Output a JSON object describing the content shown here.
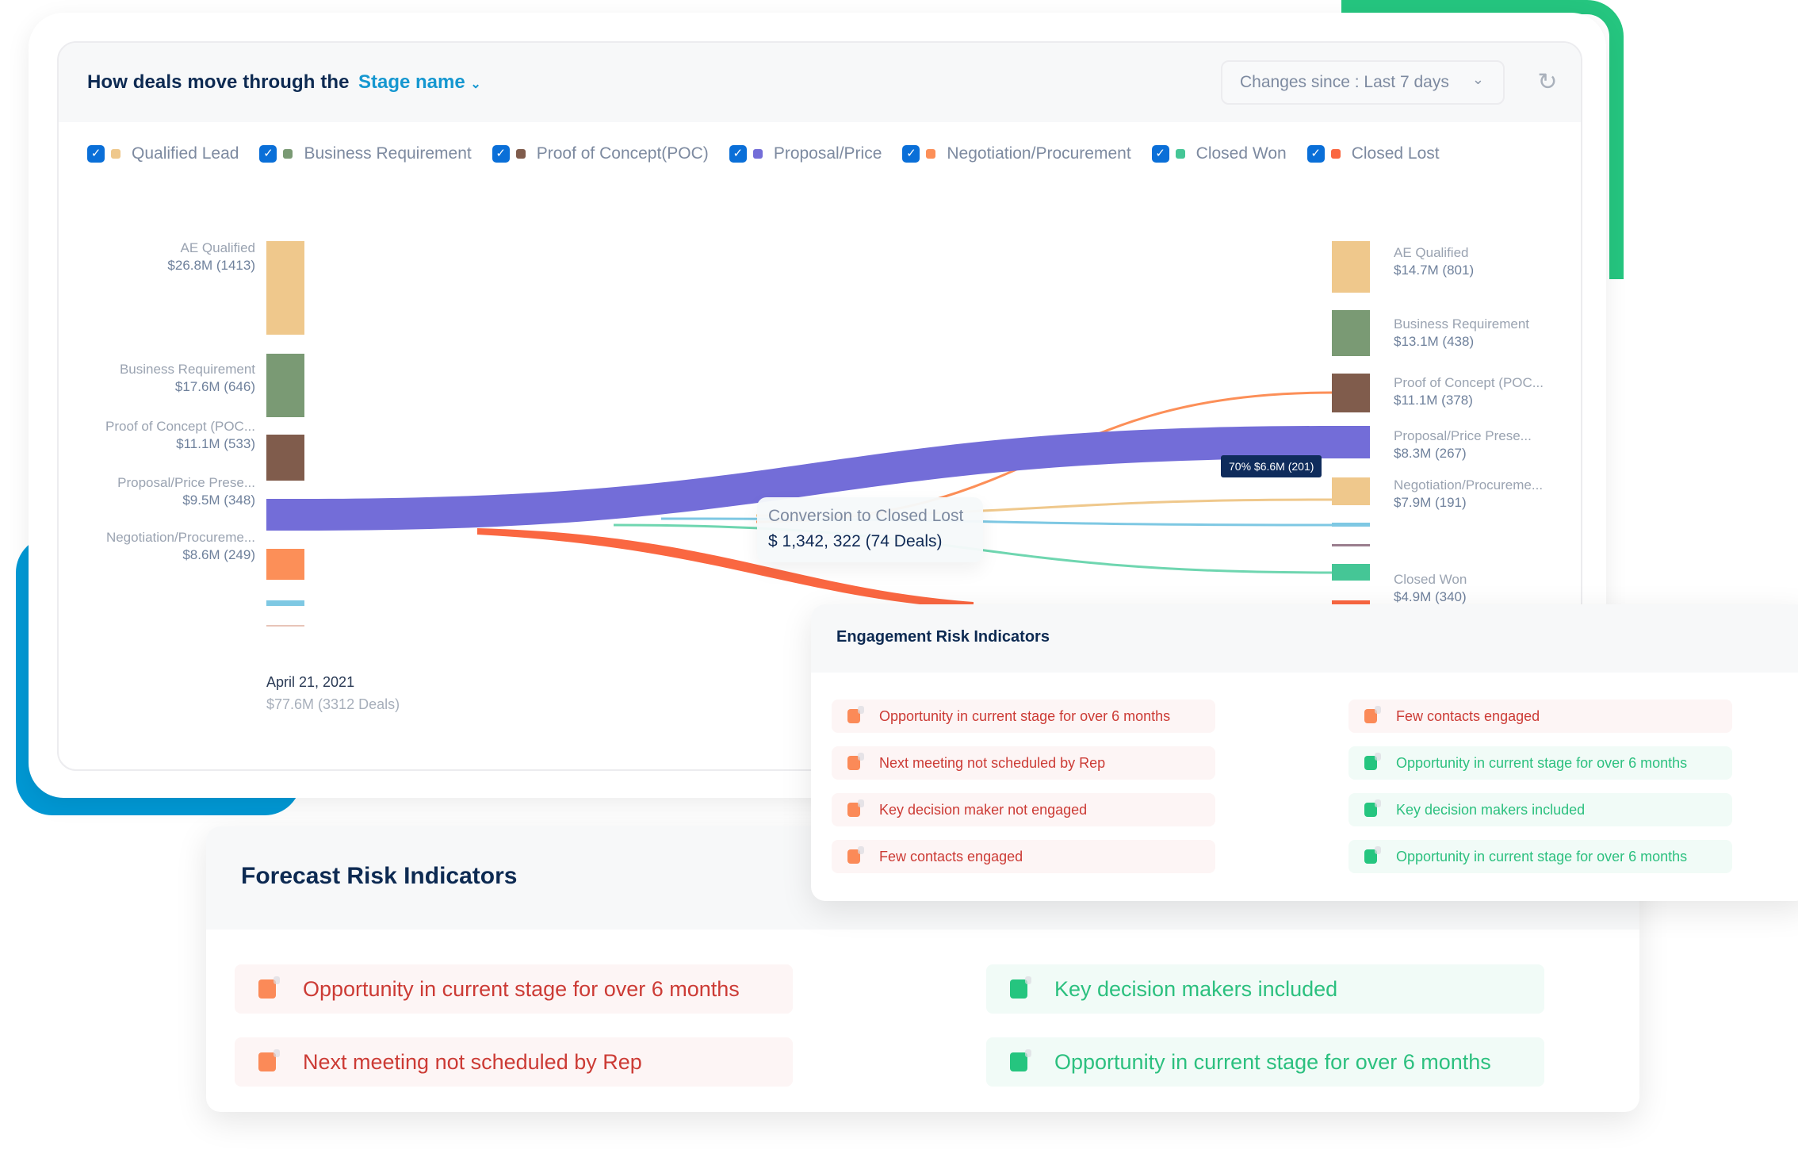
{
  "flow_card": {
    "title": "How deals move through the",
    "stage_dropdown": "Stage name",
    "changes_since": "Changes since : Last 7 days",
    "legend": [
      {
        "label": "Qualified Lead",
        "color": "#efc88c",
        "checked": true
      },
      {
        "label": "Business Requirement",
        "color": "#7a9a74",
        "checked": true
      },
      {
        "label": "Proof of Concept(POC)",
        "color": "#805c4c",
        "checked": true
      },
      {
        "label": "Proposal/Price",
        "color": "#736dd8",
        "checked": true
      },
      {
        "label": "Negotiation/Procurement",
        "color": "#fc8f58",
        "checked": true
      },
      {
        "label": "Closed Won",
        "color": "#45c696",
        "checked": true
      },
      {
        "label": "Closed Lost",
        "color": "#fa6741",
        "checked": true
      }
    ],
    "left_nodes": [
      {
        "name": "AE Qualified",
        "value": "$26.8M (1413)"
      },
      {
        "name": "Business Requirement",
        "value": "$17.6M (646)"
      },
      {
        "name": "Proof of Concept (POC...",
        "value": "$11.1M (533)"
      },
      {
        "name": "Proposal/Price Prese...",
        "value": "$9.5M (348)"
      },
      {
        "name": "Negotiation/Procureme...",
        "value": "$8.6M (249)"
      }
    ],
    "right_nodes": [
      {
        "name": "AE Qualified",
        "value": "$14.7M (801)"
      },
      {
        "name": "Business Requirement",
        "value": "$13.1M (438)"
      },
      {
        "name": "Proof of Concept (POC...",
        "value": "$11.1M (378)"
      },
      {
        "name": "Proposal/Price Prese...",
        "value": "$8.3M (267)"
      },
      {
        "name": "Negotiation/Procureme...",
        "value": "$7.9M (191)"
      },
      {
        "name": "Closed Won",
        "value": "$4.9M (340)"
      }
    ],
    "start_date": "April 21, 2021",
    "start_total": "$77.6M (3312 Deals)",
    "flow_tooltip": "70%  $6.6M (201)",
    "conversion_tooltip": {
      "title": "Conversion to Closed Lost",
      "value": "$ 1,342, 322 (74 Deals)"
    }
  },
  "engagement": {
    "title": "Engagement Risk Indicators",
    "left": [
      {
        "text": "Opportunity in current stage for over 6 months",
        "status": "risk"
      },
      {
        "text": "Next meeting not scheduled by Rep",
        "status": "risk"
      },
      {
        "text": "Key decision maker not engaged",
        "status": "risk"
      },
      {
        "text": "Few contacts engaged",
        "status": "risk"
      }
    ],
    "right": [
      {
        "text": "Few contacts engaged",
        "status": "risk"
      },
      {
        "text": "Opportunity in current stage for over 6 months",
        "status": "good"
      },
      {
        "text": "Key decision makers included",
        "status": "good"
      },
      {
        "text": "Opportunity in current stage for over 6 months",
        "status": "good"
      }
    ]
  },
  "forecast": {
    "title": "Forecast Risk Indicators",
    "left": [
      {
        "text": "Opportunity in current stage for over 6 months",
        "status": "risk"
      },
      {
        "text": "Next meeting not scheduled by Rep",
        "status": "risk"
      }
    ],
    "right": [
      {
        "text": "Key decision makers included",
        "status": "good"
      },
      {
        "text": "Opportunity in current stage for over 6 months",
        "status": "good"
      }
    ]
  },
  "colors": {
    "risk": "#cc3b35",
    "good": "#2cc07f",
    "accent_green": "#25c57f",
    "accent_blue": "#0098d4",
    "flow_purple": "#736dd8"
  }
}
